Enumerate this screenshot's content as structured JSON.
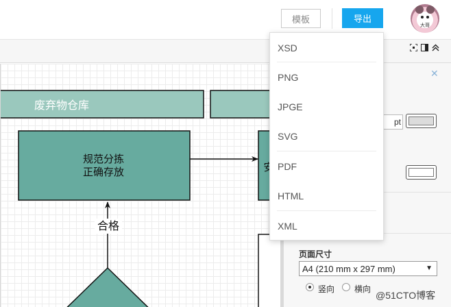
{
  "header": {
    "template_label": "模板",
    "export_label": "导出",
    "avatar_text": "大哥"
  },
  "export_menu": {
    "items": [
      "XSD",
      "PNG",
      "JPGE",
      "SVG",
      "PDF",
      "HTML",
      "XML"
    ]
  },
  "diagram": {
    "lane_label": "废弃物仓库",
    "node_main_line1": "规范分拣",
    "node_main_line2": "正确存放",
    "node_partial": "安",
    "edge_label": "合格"
  },
  "format_panel": {
    "pt_unit": "pt",
    "page_size_label": "页面尺寸",
    "page_size_value": "A4 (210 mm x 297 mm)",
    "orientation_portrait": "竖向",
    "orientation_landscape": "横向",
    "orientation_selected": "竖向"
  },
  "watermark": "@51CTO博客",
  "colors": {
    "accent": "#16a6ee",
    "lane_fill": "#9ac8bd",
    "node_fill": "#67ab9f"
  },
  "icons": {
    "fit": "fit-page-icon",
    "panel": "toggle-panel-icon",
    "collapse": "collapse-up-icon",
    "close": "close-icon"
  }
}
